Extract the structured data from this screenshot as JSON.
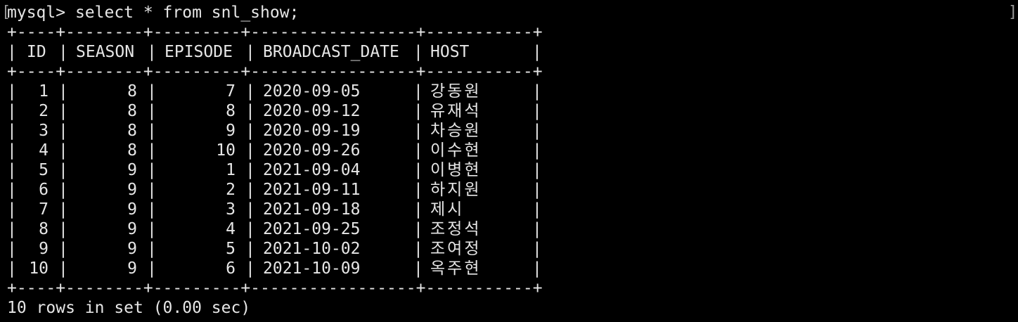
{
  "terminal": {
    "prompt": "mysql> ",
    "command": "select * from snl_show;",
    "border": "+----+--------+---------+-----------------+-----------+",
    "columns": [
      "ID",
      "SEASON",
      "EPISODE",
      "BROADCAST_DATE",
      "HOST"
    ],
    "rows": [
      {
        "id": "1",
        "season": "8",
        "episode": "7",
        "date": "2020-09-05",
        "host": "강동원"
      },
      {
        "id": "2",
        "season": "8",
        "episode": "8",
        "date": "2020-09-12",
        "host": "유재석"
      },
      {
        "id": "3",
        "season": "8",
        "episode": "9",
        "date": "2020-09-19",
        "host": "차승원"
      },
      {
        "id": "4",
        "season": "8",
        "episode": "10",
        "date": "2020-09-26",
        "host": "이수현"
      },
      {
        "id": "5",
        "season": "9",
        "episode": "1",
        "date": "2021-09-04",
        "host": "이병현"
      },
      {
        "id": "6",
        "season": "9",
        "episode": "2",
        "date": "2021-09-11",
        "host": "하지원"
      },
      {
        "id": "7",
        "season": "9",
        "episode": "3",
        "date": "2021-09-18",
        "host": "제시"
      },
      {
        "id": "8",
        "season": "9",
        "episode": "4",
        "date": "2021-09-25",
        "host": "조정석"
      },
      {
        "id": "9",
        "season": "9",
        "episode": "5",
        "date": "2021-10-02",
        "host": "조여정"
      },
      {
        "id": "10",
        "season": "9",
        "episode": "6",
        "date": "2021-10-09",
        "host": "옥주현"
      }
    ],
    "summary": "10 rows in set (0.00 sec)",
    "colors": {
      "background": "#000000",
      "text": "#e6e6e6"
    }
  }
}
